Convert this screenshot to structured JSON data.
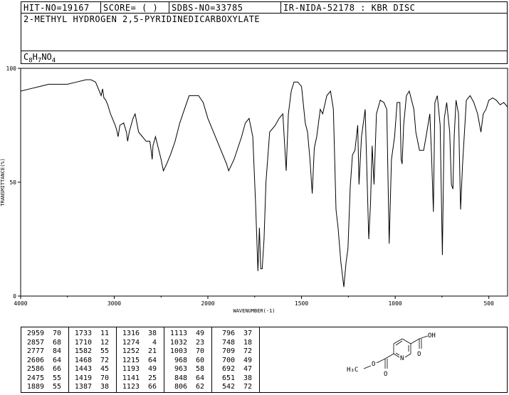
{
  "header": {
    "hit_no": "HIT-NO=19167",
    "score": "SCORE=  (   )",
    "sdbs_no": "SDBS-NO=33785",
    "ir_no": "IR-NIDA-52178 : KBR DISC",
    "compound_name": "2-METHYL HYDROGEN 2,5-PYRIDINEDICARBOXYLATE",
    "formula": {
      "c": "C",
      "c_n": "8",
      "h": "H",
      "h_n": "7",
      "n": "N",
      "o": "O",
      "o_n": "4"
    }
  },
  "chart_data": {
    "type": "line",
    "xlabel": "WAVENUMBER(-1)",
    "ylabel": "TRANSMITTANCE(%)",
    "xlim": [
      4000,
      400
    ],
    "ylim": [
      0,
      100
    ],
    "x_ticks": [
      "4000",
      "3000",
      "2000",
      "1500",
      "1000",
      "500"
    ],
    "y_ticks": [
      "100",
      "50",
      "0"
    ],
    "grid": false,
    "series": [
      {
        "x": [
          4000,
          3900,
          3800,
          3700,
          3600,
          3500,
          3400,
          3300,
          3250,
          3200,
          3160,
          3140,
          3125,
          3110,
          3090,
          3070,
          3040,
          3020,
          2990,
          2975,
          2959,
          2940,
          2900,
          2870,
          2857,
          2840,
          2800,
          2777,
          2740,
          2700,
          2660,
          2620,
          2606,
          2595,
          2586,
          2560,
          2500,
          2475,
          2440,
          2400,
          2350,
          2300,
          2250,
          2200,
          2100,
          2050,
          2000,
          1950,
          1900,
          1889,
          1860,
          1820,
          1800,
          1780,
          1760,
          1745,
          1733,
          1725,
          1718,
          1710,
          1700,
          1690,
          1670,
          1640,
          1620,
          1600,
          1582,
          1570,
          1555,
          1540,
          1520,
          1500,
          1480,
          1468,
          1455,
          1443,
          1432,
          1419,
          1400,
          1387,
          1365,
          1345,
          1330,
          1316,
          1305,
          1290,
          1274,
          1262,
          1252,
          1240,
          1228,
          1215,
          1200,
          1193,
          1180,
          1160,
          1141,
          1132,
          1123,
          1113,
          1100,
          1080,
          1060,
          1045,
          1032,
          1020,
          1003,
          990,
          975,
          968,
          963,
          955,
          940,
          925,
          900,
          890,
          870,
          848,
          835,
          815,
          806,
          796,
          788,
          775,
          760,
          748,
          738,
          725,
          709,
          700,
          692,
          685,
          675,
          662,
          651,
          640,
          620,
          600,
          580,
          560,
          542,
          530,
          515,
          500,
          480,
          460,
          440,
          420,
          400
        ],
        "y": [
          90,
          91,
          92,
          93,
          93,
          93,
          94,
          95,
          95,
          94,
          90,
          88,
          91,
          87,
          86,
          84,
          80,
          78,
          75,
          73,
          70,
          75,
          76,
          72,
          68,
          72,
          78,
          80,
          72,
          70,
          68,
          68,
          64,
          60,
          66,
          70,
          60,
          55,
          58,
          62,
          68,
          76,
          82,
          88,
          88,
          85,
          78,
          68,
          58,
          55,
          60,
          70,
          76,
          78,
          70,
          40,
          11,
          30,
          12,
          12,
          25,
          50,
          72,
          75,
          78,
          80,
          55,
          80,
          90,
          94,
          94,
          92,
          76,
          72,
          60,
          45,
          65,
          70,
          82,
          80,
          88,
          90,
          82,
          38,
          30,
          15,
          4,
          15,
          21,
          48,
          62,
          64,
          75,
          49,
          70,
          82,
          25,
          40,
          66,
          49,
          80,
          86,
          85,
          82,
          23,
          60,
          70,
          85,
          85,
          60,
          58,
          75,
          88,
          90,
          82,
          72,
          64,
          64,
          70,
          80,
          62,
          37,
          85,
          88,
          75,
          18,
          78,
          85,
          72,
          49,
          47,
          70,
          86,
          80,
          38,
          58,
          86,
          88,
          85,
          80,
          72,
          80,
          82,
          86,
          87,
          86,
          84,
          85,
          83
        ]
      }
    ],
    "peaks": [
      {
        "wn": "2959",
        "t": "70"
      },
      {
        "wn": "2857",
        "t": "68"
      },
      {
        "wn": "2777",
        "t": "84"
      },
      {
        "wn": "2606",
        "t": "64"
      },
      {
        "wn": "2586",
        "t": "66"
      },
      {
        "wn": "2475",
        "t": "55"
      },
      {
        "wn": "1889",
        "t": "55"
      },
      {
        "wn": "1733",
        "t": "11"
      },
      {
        "wn": "1710",
        "t": "12"
      },
      {
        "wn": "1582",
        "t": "55"
      },
      {
        "wn": "1468",
        "t": "72"
      },
      {
        "wn": "1443",
        "t": "45"
      },
      {
        "wn": "1419",
        "t": "70"
      },
      {
        "wn": "1387",
        "t": "38"
      },
      {
        "wn": "1316",
        "t": "38"
      },
      {
        "wn": "1274",
        "t": "4"
      },
      {
        "wn": "1252",
        "t": "21"
      },
      {
        "wn": "1215",
        "t": "64"
      },
      {
        "wn": "1193",
        "t": "49"
      },
      {
        "wn": "1141",
        "t": "25"
      },
      {
        "wn": "1123",
        "t": "66"
      },
      {
        "wn": "1113",
        "t": "49"
      },
      {
        "wn": "1032",
        "t": "23"
      },
      {
        "wn": "1003",
        "t": "70"
      },
      {
        "wn": "968",
        "t": "60"
      },
      {
        "wn": "963",
        "t": "58"
      },
      {
        "wn": "848",
        "t": "64"
      },
      {
        "wn": "806",
        "t": "62"
      },
      {
        "wn": "796",
        "t": "37"
      },
      {
        "wn": "748",
        "t": "18"
      },
      {
        "wn": "709",
        "t": "72"
      },
      {
        "wn": "700",
        "t": "49"
      },
      {
        "wn": "692",
        "t": "47"
      },
      {
        "wn": "651",
        "t": "38"
      },
      {
        "wn": "542",
        "t": "72"
      }
    ]
  },
  "structure": {
    "label_ch3": "H₃C",
    "label_o_ether": "O",
    "label_o_carbonyl": "O",
    "label_n": "N",
    "label_oh": "OH",
    "label_o_acid": "O"
  }
}
